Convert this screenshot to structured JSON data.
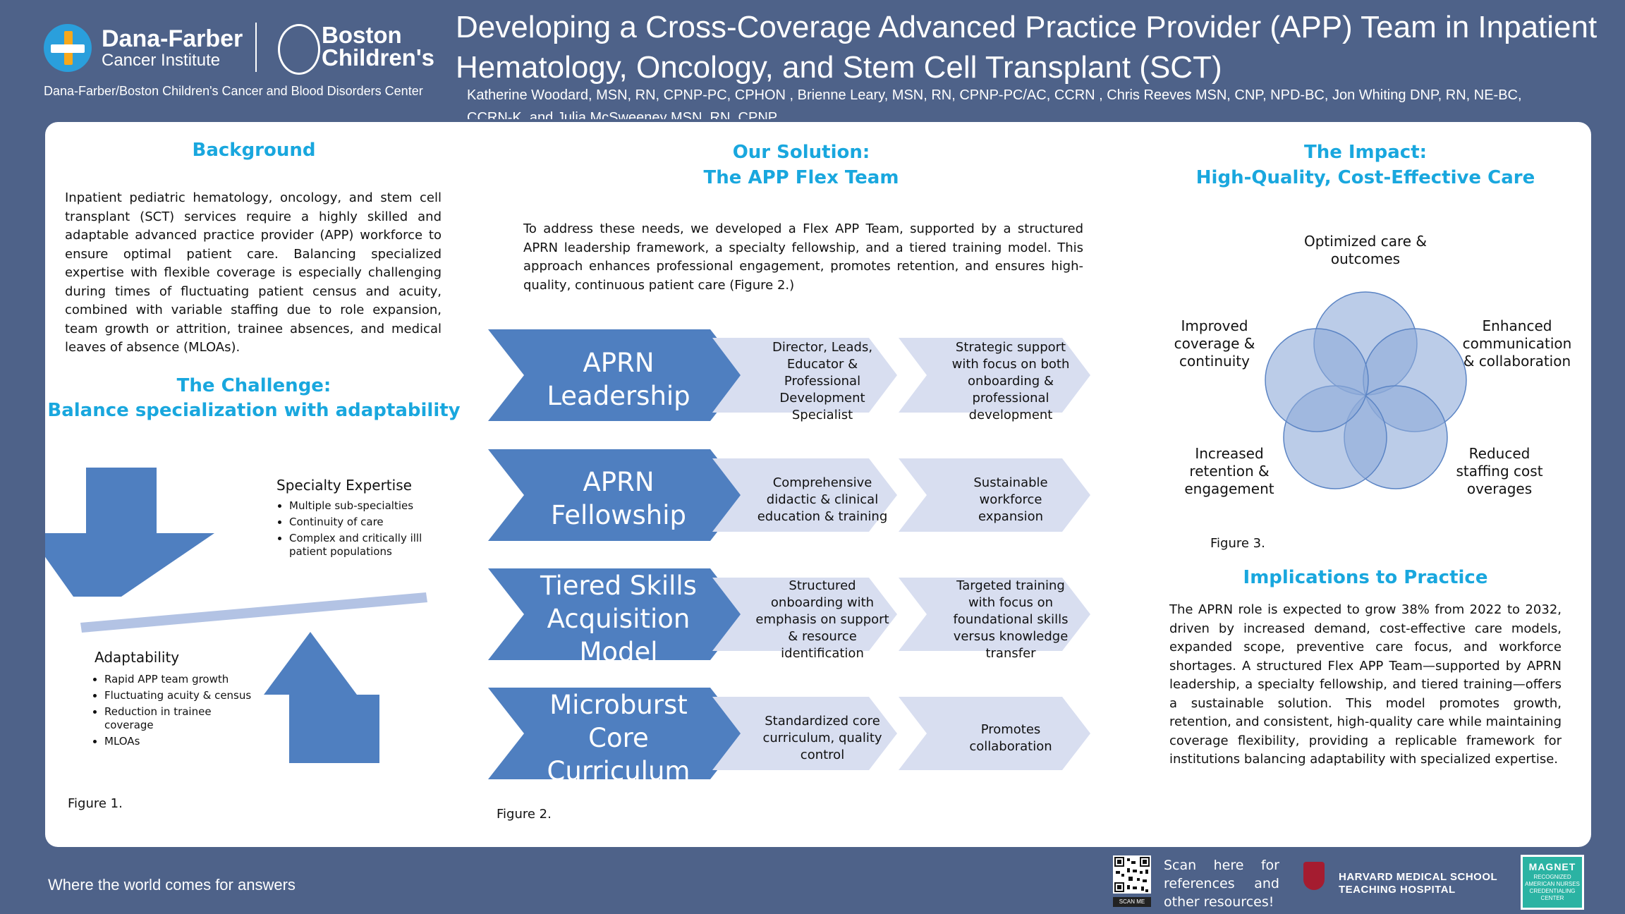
{
  "header": {
    "df_name": "Dana-Farber",
    "df_sub": "Cancer Institute",
    "bch_name": "Boston Children's",
    "center": "Dana-Farber/Boston Children's Cancer and Blood Disorders Center",
    "title": "Developing a Cross-Coverage Advanced Practice Provider (APP) Team in Inpatient Hematology, Oncology, and Stem Cell Transplant (SCT)",
    "authors": "Katherine Woodard, MSN, RN, CPNP-PC, CPHON , Brienne Leary, MSN, RN, CPNP-PC/AC, CCRN , Chris Reeves MSN, CNP, NPD-BC, Jon Whiting DNP, RN, NE-BC, CCRN-K, and Julia McSweeney MSN, RN, CPNP"
  },
  "background": {
    "heading": "Background",
    "text": "Inpatient pediatric hematology, oncology, and stem cell transplant (SCT) services require a highly skilled and adaptable advanced practice provider (APP) workforce to ensure optimal patient care. Balancing specialized expertise with flexible coverage is especially challenging during times of fluctuating patient census and acuity, combined with variable staffing due to role expansion, team growth or attrition, trainee absences, and medical leaves of absence (MLOAs)."
  },
  "challenge": {
    "heading_line1": "The Challenge:",
    "heading_line2": "Balance specialization with adaptability",
    "specialty_title": "Specialty Expertise",
    "specialty_items": [
      "Multiple sub-specialties",
      "Continuity of care",
      "Complex and critically illl patient populations"
    ],
    "adapt_title": "Adaptability",
    "adapt_items": [
      "Rapid APP team growth",
      "Fluctuating acuity & census",
      "Reduction in trainee coverage",
      "MLOAs"
    ],
    "figure_caption": "Figure 1.",
    "colors": {
      "arrow": "#4f7fc0",
      "beam": "#b3c3e4"
    }
  },
  "solution": {
    "heading_line1": "Our Solution:",
    "heading_line2": "The APP Flex Team",
    "text": "To address these needs, we developed a Flex APP Team, supported by a structured APRN leadership framework, a specialty fellowship, and a tiered training model. This approach enhances professional engagement, promotes retention, and ensures high-quality, continuous patient care (Figure 2.)",
    "rows": [
      {
        "label": "APRN Leadership",
        "cell1": "Director, Leads, Educator & Professional Development Specialist",
        "cell2": "Strategic support with focus on both onboarding & professional development"
      },
      {
        "label": "APRN Fellowship",
        "cell1": "Comprehensive didactic & clinical education & training",
        "cell2": "Sustainable workforce expansion"
      },
      {
        "label": "Tiered Skills Acquisition Model",
        "cell1": "Structured onboarding with emphasis on support & resource identification",
        "cell2": "Targeted training with focus on foundational skills versus knowledge transfer"
      },
      {
        "label": "Microburst Core Curriculum",
        "cell1": "Standardized core curriculum, quality control",
        "cell2": "Promotes collaboration"
      }
    ],
    "figure_caption": "Figure 2.",
    "colors": {
      "chevron_main": "#4f7fc0",
      "chevron_light": "#d8def0"
    }
  },
  "impact": {
    "heading_line1": "The Impact:",
    "heading_line2": "High-Quality, Cost-Effective Care",
    "venn_labels": [
      "Optimized care & outcomes",
      "Enhanced communication & collaboration",
      "Reduced staffing cost overages",
      "Increased retention & engagement",
      "Improved coverage & continuity"
    ],
    "figure_caption": "Figure 3.",
    "colors": {
      "circle_fill": "#8eaad8",
      "circle_stroke": "#5b84c4"
    }
  },
  "implications": {
    "heading": "Implications to Practice",
    "text": "The APRN role is expected to grow 38% from 2022 to 2032, driven by increased demand, cost-effective care models, expanded scope, preventive care focus, and workforce shortages. A structured Flex APP Team—supported by APRN leadership, a specialty fellowship, and tiered training—offers a sustainable solution. This model promotes growth, retention, and consistent, high-quality care while maintaining coverage flexibility, providing a replicable framework for institutions balancing adaptability with specialized expertise."
  },
  "footer": {
    "tagline": "Where the world comes for answers",
    "qr_label": "SCAN ME",
    "scan_text": "Scan here for references and other resources!",
    "harvard_line1": "HARVARD MEDICAL SCHOOL",
    "harvard_line2": "TEACHING HOSPITAL",
    "magnet_word": "MAGNET",
    "magnet_sub": "RECOGNIZED AMERICAN NURSES CREDENTIALING CENTER"
  }
}
